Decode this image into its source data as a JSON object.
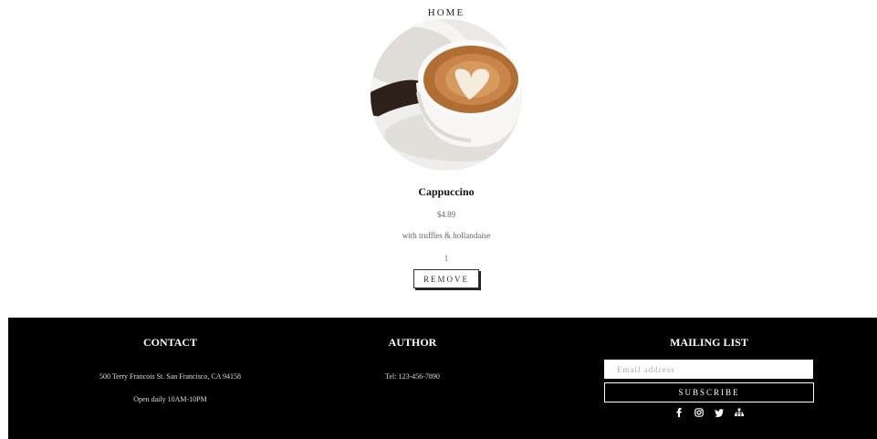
{
  "nav": {
    "home": "HOME"
  },
  "product": {
    "name": "Cappuccino",
    "price": "$4.89",
    "description": "with truffles & hollandaise",
    "quantity": "1",
    "remove_label": "REMOVE"
  },
  "footer": {
    "contact": {
      "title": "CONTACT",
      "address": "500 Terry Francois St. San Francisco, CA 94158",
      "hours": "Open daily 10AM-10PM"
    },
    "author": {
      "title": "AUTHOR",
      "phone": "Tel: 123-456-7890"
    },
    "mailing": {
      "title": "MAILING LIST",
      "email_placeholder": "Email address",
      "subscribe_label": "SUBSCRIBE",
      "social_icons": [
        "facebook-icon",
        "instagram-icon",
        "twitter-icon",
        "sitemap-icon"
      ]
    }
  },
  "colors": {
    "footer_bg": "#000000",
    "page_bg": "#ffffff"
  }
}
